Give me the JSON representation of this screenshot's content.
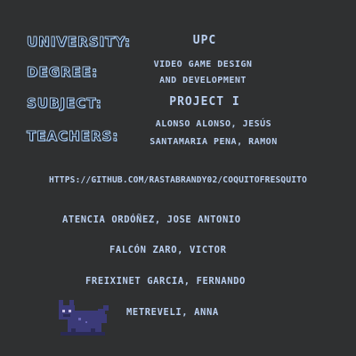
{
  "info": {
    "university_label": "University:",
    "university_value": "UPC",
    "degree_label": "Degree:",
    "degree_line1": "Video Game Design",
    "degree_line2": "and Development",
    "subject_label": "Subject:",
    "subject_value": "Project I",
    "teachers_label": "Teachers:",
    "teachers_line1": "Alonso Alonso, Jesús",
    "teachers_line2": "Santamaria Pena, Ramon"
  },
  "repo_link": "https://github.com/rastabrandy02/coquitofresquito",
  "credits": [
    "Atencia Ordóñez, Jose Antonio",
    "Falcón Zaro, Victor",
    "Freixinet Garcia, Fernando",
    "Metreveli, Anna"
  ],
  "colors": {
    "background": "#2f3031",
    "text": "#b9cff0",
    "label_fill": "#0b1326",
    "label_outline": "#aecde8",
    "creature_body": "#3b3a78",
    "creature_shadow": "#2a2a55"
  },
  "sprite": "purple-cat-creature-icon"
}
